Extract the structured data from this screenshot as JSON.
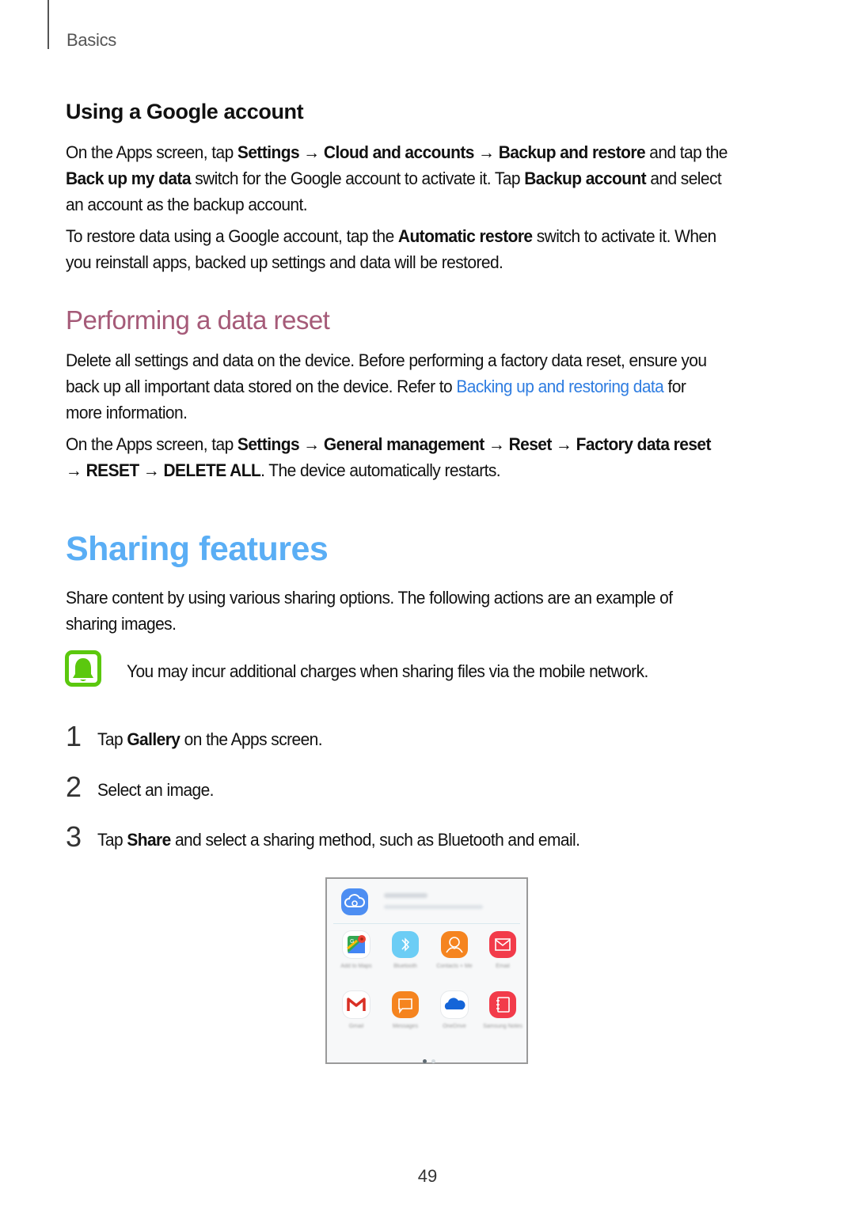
{
  "header": {
    "label": "Basics"
  },
  "google_account": {
    "title": "Using a Google account",
    "para1": [
      {
        "t": "On the Apps screen, tap "
      },
      {
        "t": "Settings",
        "b": true
      },
      {
        "t": " → "
      },
      {
        "t": "Cloud and accounts",
        "b": true
      },
      {
        "t": " → "
      },
      {
        "t": "Backup and restore",
        "b": true
      },
      {
        "t": " and tap the"
      }
    ],
    "para1_line2": [
      {
        "t": "Back up my data",
        "b": true
      },
      {
        "t": " switch for the Google account to activate it. Tap "
      },
      {
        "t": "Backup account",
        "b": true
      },
      {
        "t": " and select"
      }
    ],
    "para1_line3": "an account as the backup account.",
    "para2_line1": [
      {
        "t": "To restore data using a Google account, tap the "
      },
      {
        "t": "Automatic restore",
        "b": true
      },
      {
        "t": " switch to activate it. When"
      }
    ],
    "para2_line2": "you reinstall apps, backed up settings and data will be restored."
  },
  "data_reset": {
    "title": "Performing a data reset",
    "para1_line1": "Delete all settings and data on the device. Before performing a factory data reset, ensure you",
    "para1_line2_pre": "back up all important data stored on the device. Refer to ",
    "para1_link": "Backing up and restoring data",
    "para1_line2_post": " for",
    "para1_line3": "more information.",
    "para2_line1": [
      {
        "t": "On the Apps screen, tap "
      },
      {
        "t": "Settings",
        "b": true
      },
      {
        "t": " → "
      },
      {
        "t": "General management",
        "b": true
      },
      {
        "t": " → "
      },
      {
        "t": "Reset",
        "b": true
      },
      {
        "t": " → "
      },
      {
        "t": "Factory data reset",
        "b": true
      }
    ],
    "para2_line2": [
      {
        "t": "→ "
      },
      {
        "t": "RESET",
        "b": true
      },
      {
        "t": " → "
      },
      {
        "t": "DELETE ALL",
        "b": true
      },
      {
        "t": ". The device automatically restarts."
      }
    ]
  },
  "sharing": {
    "title": "Sharing features",
    "intro_line1": "Share content by using various sharing options. The following actions are an example of",
    "intro_line2": "sharing images.",
    "note": "You may incur additional charges when sharing files via the mobile network.",
    "note_icon": "bell-icon",
    "steps": [
      {
        "num": "1",
        "parts": [
          {
            "t": "Tap "
          },
          {
            "t": "Gallery",
            "b": true
          },
          {
            "t": " on the Apps screen."
          }
        ]
      },
      {
        "num": "2",
        "parts": [
          {
            "t": "Select an image."
          }
        ]
      },
      {
        "num": "3",
        "parts": [
          {
            "t": "Tap "
          },
          {
            "t": "Share",
            "b": true
          },
          {
            "t": " and select a sharing method, such as Bluetooth and email."
          }
        ]
      }
    ],
    "screenshot": {
      "link_sharing": "Link Sharing",
      "apps": [
        {
          "label": "Add to Maps",
          "icon": "maps-icon",
          "color": "#ffffff"
        },
        {
          "label": "Bluetooth",
          "icon": "bluetooth-icon",
          "color": "#6ccdf5"
        },
        {
          "label": "Contacts + Me",
          "icon": "contacts-icon",
          "color": "#f5841f"
        },
        {
          "label": "Email",
          "icon": "email-icon",
          "color": "#f23b4a"
        },
        {
          "label": "Gmail",
          "icon": "gmail-icon",
          "color": "#ffffff"
        },
        {
          "label": "Messages",
          "icon": "messages-icon",
          "color": "#f5841f"
        },
        {
          "label": "OneDrive",
          "icon": "onedrive-icon",
          "color": "#ffffff"
        },
        {
          "label": "Samsung Notes",
          "icon": "notes-icon",
          "color": "#f23b4a"
        }
      ],
      "pages": 2,
      "active_page": 1
    }
  },
  "page_number": "49",
  "colors": {
    "section_heading": "#a55a78",
    "chapter_heading": "#5aaef5",
    "link": "#2f7de1",
    "note_icon": "#5bc80e"
  }
}
